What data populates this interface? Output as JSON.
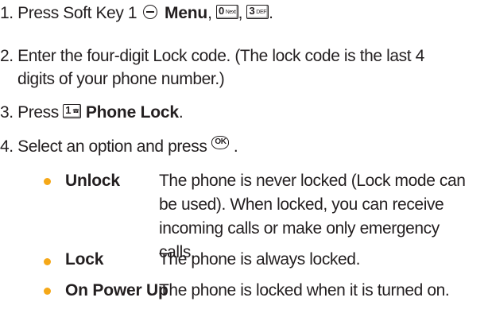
{
  "steps": {
    "step1": {
      "text": "1. Press Soft Key 1",
      "bold": "Menu",
      "sep1": ",",
      "key0_main": "0",
      "key0_sub": "Next",
      "key3_main": "3",
      "key3_sub": "DEF",
      "end": "."
    },
    "step2": {
      "line1": "2. Enter the four-digit Lock code. (The lock code is the last 4",
      "line2": "digits of your phone number.)"
    },
    "step3": {
      "text": "3. Press",
      "key1_main": "1",
      "key1_sub": "☎",
      "bold": "Phone Lock",
      "end": "."
    },
    "step4": {
      "text": "4. Select an option and press",
      "ok_label": "OK",
      "end": "."
    }
  },
  "options": [
    {
      "term": "Unlock",
      "lines": [
        "The phone is never locked (Lock mode can",
        "be used). When locked, you can receive",
        "incoming calls or make only emergency",
        "calls."
      ]
    },
    {
      "term": "Lock",
      "lines": [
        "The phone is always locked."
      ]
    },
    {
      "term": "On Power Up",
      "lines": [
        "The phone is locked when it is turned on."
      ]
    }
  ],
  "colors": {
    "text": "#231f20",
    "bullet": "#f5a818"
  },
  "icons": {
    "soft_key": "soft-key-1-icon",
    "ok_key": "ok-key-icon"
  }
}
